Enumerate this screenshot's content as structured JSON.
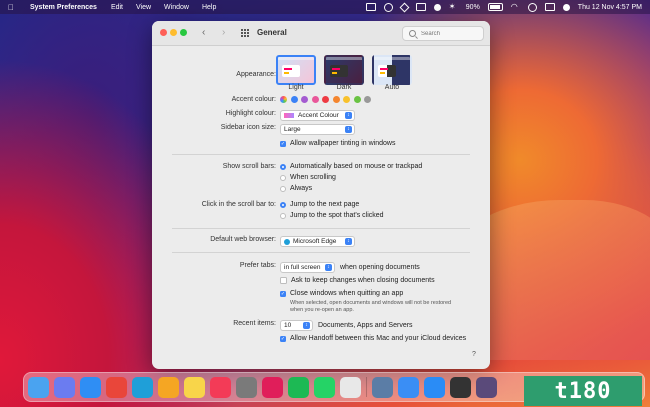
{
  "menubar": {
    "app_name": "System Preferences",
    "menus": [
      "Edit",
      "View",
      "Window",
      "Help"
    ],
    "battery_percent": "90%",
    "datetime": "Thu 12 Nov  4:57 PM",
    "icons": [
      "box-icon",
      "circle-icon",
      "diamond-icon",
      "cloud-icon",
      "bluetooth-icon",
      "battery-icon",
      "wifi-icon",
      "search-icon",
      "control-center-icon",
      "siri-icon"
    ]
  },
  "window": {
    "title": "General",
    "search_placeholder": "Search",
    "help": "?"
  },
  "general": {
    "appearance_label": "Appearance:",
    "appearance_options": [
      "Light",
      "Dark",
      "Auto"
    ],
    "appearance_selected": "Light",
    "accent_label": "Accent colour:",
    "accent_colors": [
      "#b8b8b8",
      "#3b82f6",
      "#a45bd1",
      "#e9579a",
      "#ee3b44",
      "#f4862f",
      "#f8c12c",
      "#6ac343",
      "#999999"
    ],
    "highlight_label": "Highlight colour:",
    "highlight_value": "Accent Colour",
    "sidebar_label": "Sidebar icon size:",
    "sidebar_value": "Large",
    "wallpaper_tint_label": "Allow wallpaper tinting in windows",
    "wallpaper_tint_checked": true
  },
  "scroll": {
    "show_label": "Show scroll bars:",
    "show_options": [
      "Automatically based on mouse or trackpad",
      "When scrolling",
      "Always"
    ],
    "show_selected": 0,
    "click_label": "Click in the scroll bar to:",
    "click_options": [
      "Jump to the next page",
      "Jump to the spot that's clicked"
    ],
    "click_selected": 0
  },
  "browser": {
    "label": "Default web browser:",
    "value": "Microsoft Edge"
  },
  "tabs": {
    "label": "Prefer tabs:",
    "value": "in full screen",
    "suffix": "when opening documents",
    "ask_keep": "Ask to keep changes when closing documents",
    "ask_keep_checked": false,
    "close_windows": "Close windows when quitting an app",
    "close_windows_checked": true,
    "close_note_1": "When selected, open documents and windows will not be restored",
    "close_note_2": "when you re-open an app.",
    "recent_label": "Recent items:",
    "recent_value": "10",
    "recent_suffix": "Documents, Apps and Servers",
    "handoff": "Allow Handoff between this Mac and your iCloud devices",
    "handoff_checked": true
  },
  "dock": {
    "apps": [
      {
        "name": "finder-icon",
        "color": "#4aa3f0"
      },
      {
        "name": "launchpad-icon",
        "color": "#6b7cf0"
      },
      {
        "name": "safari-icon",
        "color": "#2f8ef4"
      },
      {
        "name": "chrome-icon",
        "color": "#e9463a"
      },
      {
        "name": "edge-icon",
        "color": "#1f9fd8"
      },
      {
        "name": "photos-icon",
        "color": "#f5a623"
      },
      {
        "name": "notes-icon",
        "color": "#f8d54a"
      },
      {
        "name": "music-icon",
        "color": "#f33b57"
      },
      {
        "name": "system-preferences-icon",
        "color": "#7a7a7a"
      },
      {
        "name": "slack-icon",
        "color": "#e01e5a"
      },
      {
        "name": "spotify-icon",
        "color": "#1db954"
      },
      {
        "name": "whatsapp-icon",
        "color": "#25d366"
      },
      {
        "name": "reminders-icon",
        "color": "#e8e8e8"
      }
    ],
    "apps2": [
      {
        "name": "preview-icon",
        "color": "#5b7da6"
      },
      {
        "name": "mail-icon",
        "color": "#3a8ef5"
      },
      {
        "name": "app-store-icon",
        "color": "#2a8cf6"
      },
      {
        "name": "migration-icon",
        "color": "#333333"
      },
      {
        "name": "screenshot-icon",
        "color": "#5a4a7a"
      }
    ],
    "watermark": "t180"
  }
}
